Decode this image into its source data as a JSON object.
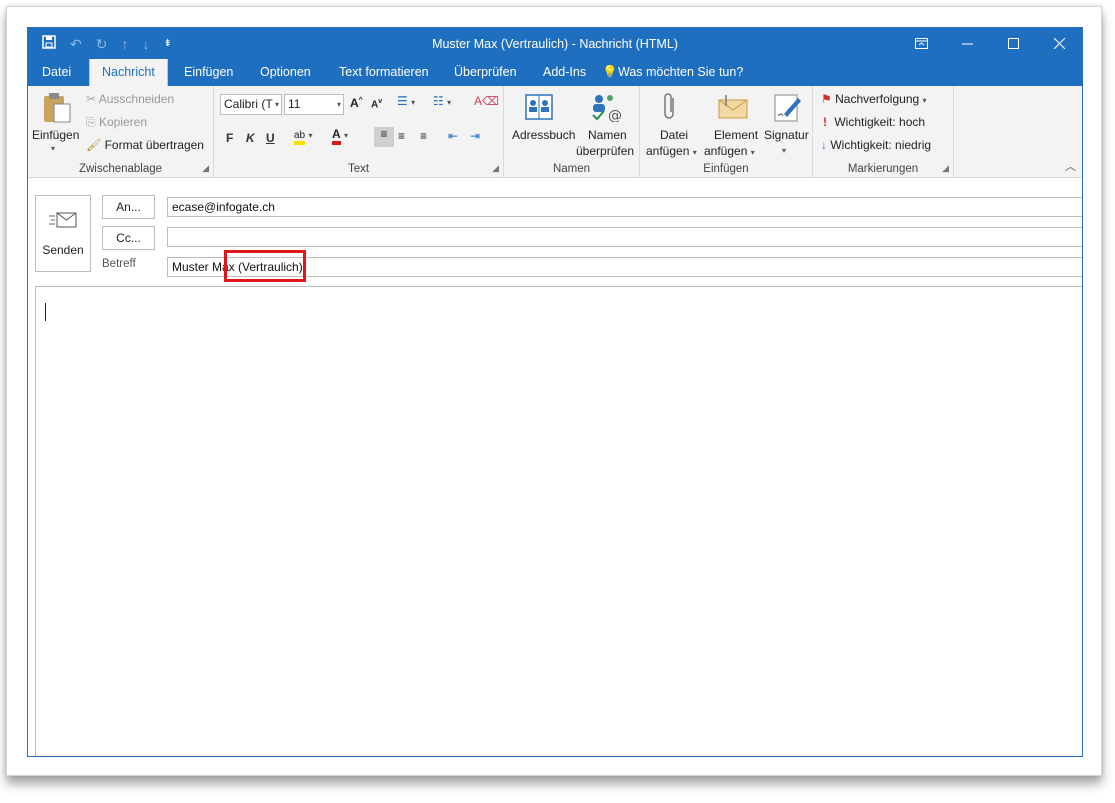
{
  "window": {
    "title": "Muster Max (Vertraulich) - Nachricht (HTML)",
    "accent": "#1f6fc1"
  },
  "qat_icons": [
    "save-icon",
    "undo-icon",
    "redo-icon",
    "arrow-up-icon",
    "arrow-down-icon",
    "customize-icon"
  ],
  "tabs": [
    {
      "label": "Datei"
    },
    {
      "label": "Nachricht",
      "active": true
    },
    {
      "label": "Einfügen"
    },
    {
      "label": "Optionen"
    },
    {
      "label": "Text formatieren"
    },
    {
      "label": "Überprüfen"
    },
    {
      "label": "Add-Ins"
    },
    {
      "label": "Was möchten Sie tun?"
    }
  ],
  "ribbon": {
    "clipboard": {
      "paste": "Einfügen",
      "cut": "Ausschneiden",
      "copy": "Kopieren",
      "format_painter": "Format übertragen",
      "label": "Zwischenablage"
    },
    "text": {
      "font": "Calibri (T",
      "size": "11",
      "bold": "F",
      "italic": "K",
      "underline": "U",
      "label": "Text"
    },
    "names": {
      "address_book": "Adressbuch",
      "check_names_1": "Namen",
      "check_names_2": "überprüfen",
      "label": "Namen"
    },
    "include": {
      "attach_file_1": "Datei",
      "attach_file_2": "anfügen",
      "attach_item_1": "Element",
      "attach_item_2": "anfügen",
      "signature": "Signatur",
      "label": "Einfügen"
    },
    "tags": {
      "follow_up": "Nachverfolgung",
      "high_importance": "Wichtigkeit: hoch",
      "low_importance": "Wichtigkeit: niedrig",
      "label": "Markierungen"
    }
  },
  "compose": {
    "send": "Senden",
    "to_button": "An...",
    "cc_button": "Cc...",
    "subject_label": "Betreff",
    "to_value": "ecase@infogate.ch",
    "cc_value": "",
    "subject_value": "Muster Max (Vertraulich)",
    "body": ""
  }
}
